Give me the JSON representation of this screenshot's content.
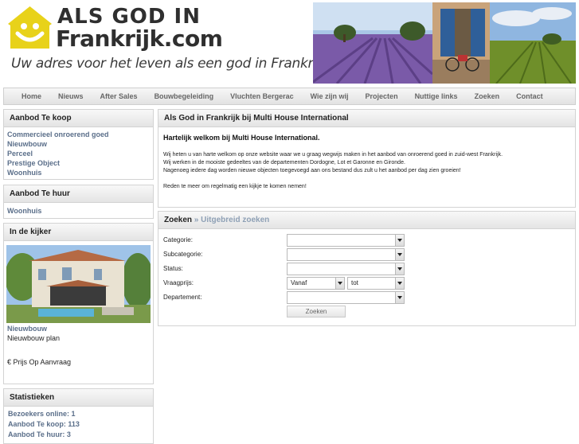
{
  "header": {
    "logo_line1": "ALS GOD IN",
    "logo_line2": "Frankrijk.com",
    "tagline": "Uw adres voor het leven als een god in Frankrijk!!"
  },
  "nav": {
    "items": [
      "Home",
      "Nieuws",
      "After Sales",
      "Bouwbegeleiding",
      "Vluchten Bergerac",
      "Wie zijn wij",
      "Projecten",
      "Nuttige links",
      "Zoeken",
      "Contact"
    ]
  },
  "sidebar": {
    "koop": {
      "title": "Aanbod Te koop",
      "items": [
        "Commercieel onroerend goed",
        "Nieuwbouw",
        "Perceel",
        "Prestige Object",
        "Woonhuis"
      ]
    },
    "huur": {
      "title": "Aanbod Te huur",
      "items": [
        "Woonhuis"
      ]
    },
    "kijker": {
      "title": "In de kijker",
      "link": "Nieuwbouw",
      "subtitle": "Nieuwbouw plan",
      "price": "€ Prijs Op Aanvraag"
    },
    "stats": {
      "title": "Statistieken",
      "lines": [
        "Bezoekers online: 1",
        "Aanbod Te koop: 113",
        "Aanbod Te huur: 3"
      ]
    }
  },
  "welcome": {
    "title": "Als God in Frankrijk bij Multi House International",
    "heading": "Hartelijk welkom bij Multi House International.",
    "paragraphs": [
      "Wij heten u van harte welkom op onze website waar we u graag wegwijs maken in het aanbod van onroerend goed in zuid-west Frankrijk.",
      "Wij werken in de mooiste gedeeltes van de departementen Dordogne, Lot et Garonne en Gironde.",
      "Nagenoeg iedere dag worden nieuwe objecten toegevoegd aan ons bestand dus zult u het aanbod per dag zien groeien!",
      "Reden te meer om regelmatig een kijkje te komen nemen!"
    ]
  },
  "search": {
    "crumb_main": "Zoeken",
    "crumb_sep": "»",
    "crumb_sub": "Uitgebreid zoeken",
    "labels": {
      "categorie": "Categorie:",
      "subcategorie": "Subcategorie:",
      "status": "Status:",
      "vraagprijs": "Vraagprijs:",
      "departement": "Departement:"
    },
    "values": {
      "categorie": "",
      "subcategorie": "",
      "status": "",
      "price_from": "Vanaf",
      "price_to": "tot",
      "departement": ""
    },
    "button": "Zoeken"
  },
  "colors": {
    "logo_yellow": "#e8d21a",
    "link_blue": "#5b6f8a",
    "breadcrumb_blue": "#8ea0b5"
  }
}
